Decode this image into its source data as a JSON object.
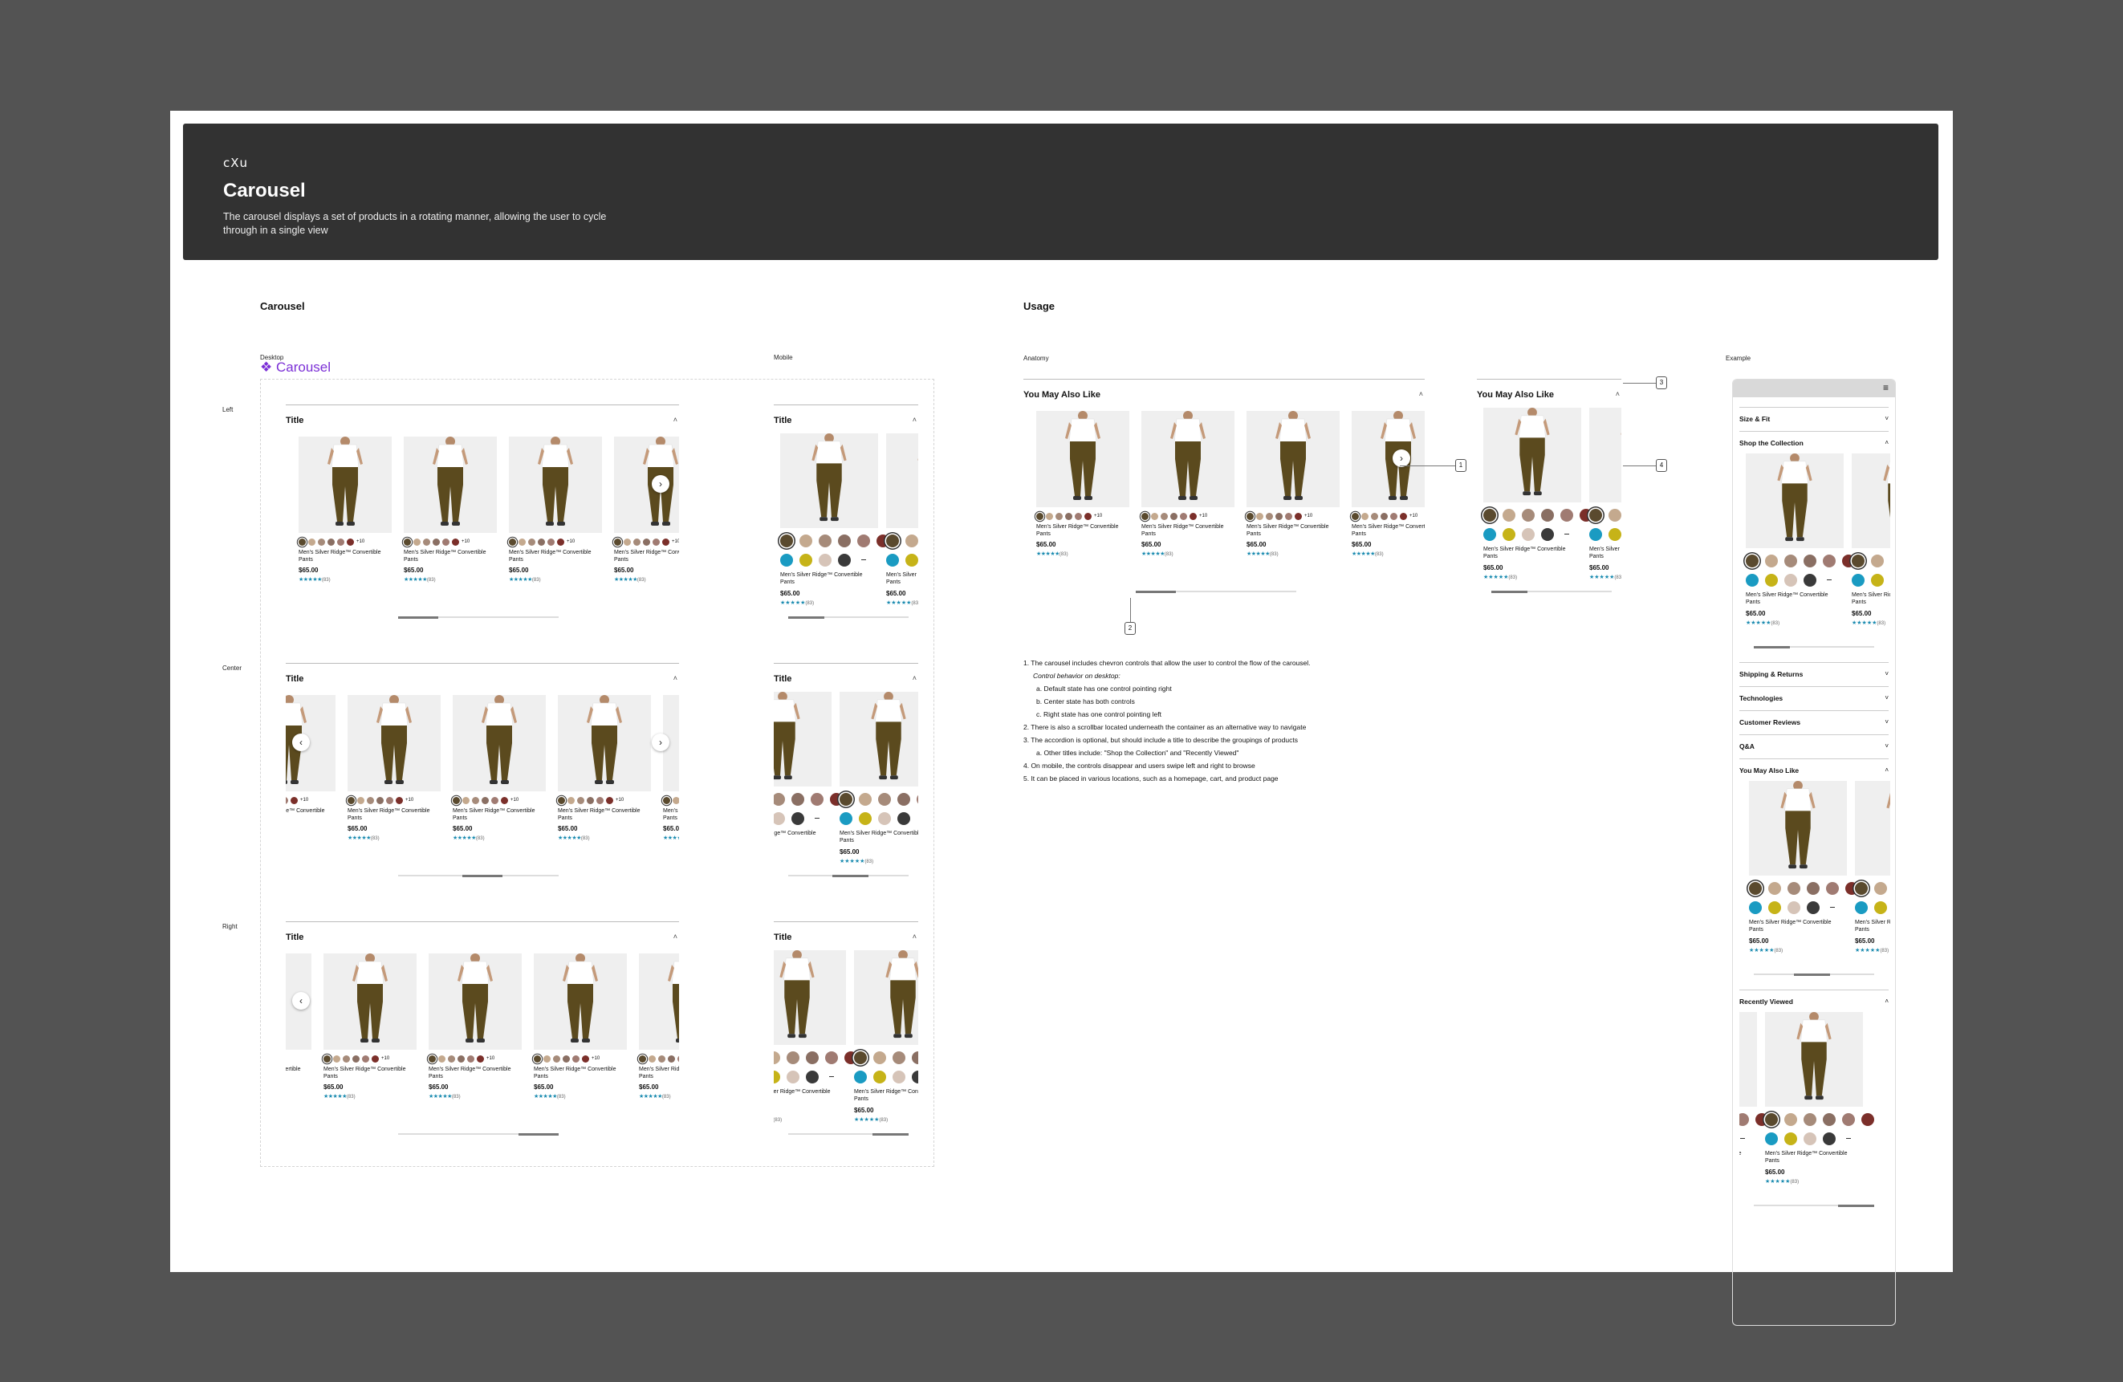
{
  "hero": {
    "logo": "cXu",
    "title": "Carousel",
    "description": "The carousel displays a set of products in a rotating manner, allowing the user to cycle through in a single view"
  },
  "sections": {
    "carousel_heading": "Carousel",
    "usage_heading": "Usage",
    "desktop_label": "Desktop",
    "carousel_tag": "Carousel",
    "mobile_label": "Mobile",
    "anatomy_label": "Anatomy",
    "example_label": "Example",
    "row_left": "Left",
    "row_center": "Center",
    "row_right": "Right"
  },
  "panel_title": "Title",
  "product": {
    "name": "Men's Silver Ridge™ Convertible Pants",
    "price": "$65.00",
    "stars": "★★★★★",
    "review_count": "(83)",
    "more_swatches": "+10"
  },
  "colors": {
    "swatches": [
      "#5a4a2e",
      "#c4a98e",
      "#a68b7a",
      "#8a6f63",
      "#a07b72",
      "#7b2f2a"
    ],
    "mobile_swatches_row1": [
      "#5a4a2e",
      "#c4a98e",
      "#a68b7a",
      "#8a6f63",
      "#a07b72",
      "#7b2f2a"
    ],
    "mobile_swatches_row2": [
      "#1a9bc2",
      "#c6b318",
      "#d6c4b8",
      "#3a3a3a"
    ],
    "pants": "#5b4a1e",
    "shirt": "#ffffff",
    "star": "#1a8bb0"
  },
  "anatomy": {
    "title": "You May Also Like",
    "callouts": [
      "1",
      "2",
      "3",
      "4"
    ],
    "notes": [
      "1. The carousel includes chevron controls that allow the user to control the flow of the carousel.",
      "Control behavior on desktop:",
      "a. Default state has one control pointing  right",
      "b. Center state has both controls",
      "c. Right state has one control pointing left",
      "2. There is also a scrollbar located underneath the container as an alternative way to navigate",
      "3. The accordion is optional, but should include a title to describe the groupings of products",
      "a. Other titles include: \"Shop the Collection\" and \"Recently Viewed\"",
      "4. On mobile, the controls disappear and users swipe left and right to browse",
      "5. It can be placed in various locations, such as a homepage, cart, and product page"
    ]
  },
  "example": {
    "menu_icon": "≡",
    "rows": [
      {
        "label": "Size & Fit",
        "chev": "˅"
      },
      {
        "label": "Shop the Collection",
        "chev": "˄"
      },
      {
        "label": "Shipping & Returns",
        "chev": "˅"
      },
      {
        "label": "Technologies",
        "chev": "˅"
      },
      {
        "label": "Customer Reviews",
        "chev": "˅"
      },
      {
        "label": "Q&A",
        "chev": "˅"
      },
      {
        "label": "You May Also Like",
        "chev": "˄"
      },
      {
        "label": "Recently Viewed",
        "chev": "˄"
      }
    ]
  },
  "nav": {
    "next": "›",
    "prev": "‹",
    "collapse": "˄"
  }
}
